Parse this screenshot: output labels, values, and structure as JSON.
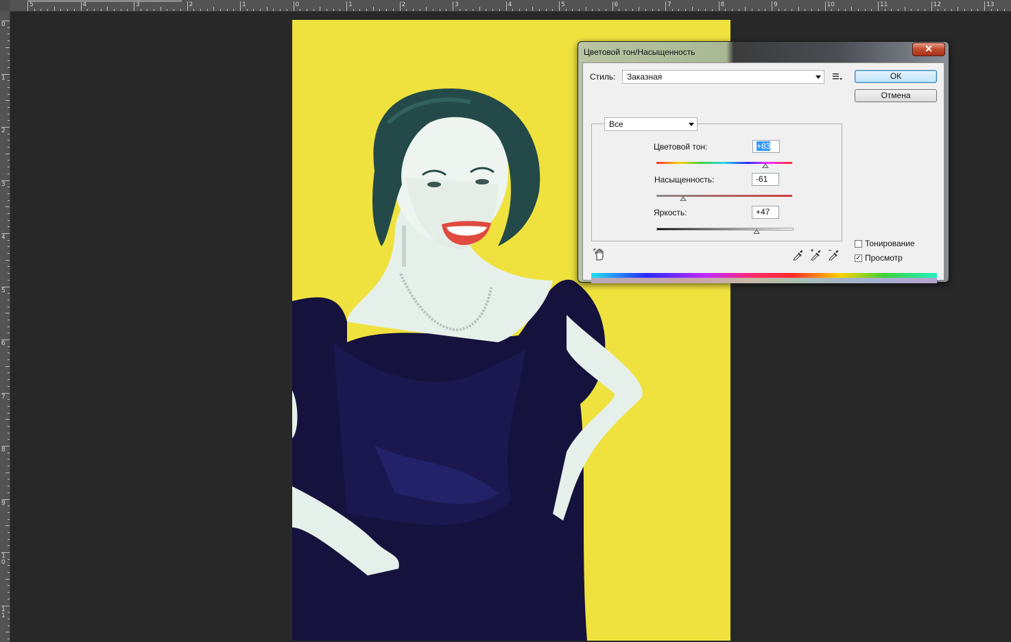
{
  "rulers": {
    "top_labels": [
      "5",
      "4",
      "3",
      "2",
      "1",
      "0",
      "1",
      "2",
      "3",
      "4",
      "5",
      "6",
      "7",
      "8",
      "9",
      "10",
      "11",
      "12",
      "13"
    ],
    "left_labels": [
      "0",
      "1",
      "2",
      "3",
      "4",
      "5",
      "6",
      "7",
      "8",
      "9",
      "1\n0",
      "1\n1"
    ]
  },
  "document": {
    "background_color": "#efe23e"
  },
  "dialog": {
    "title": "Цветовой тон/Насыщенность",
    "close_label": "✕",
    "preset_label": "Стиль:",
    "preset_value": "Заказная",
    "ok_label": "ОК",
    "cancel_label": "Отмена",
    "channel_value": "Все",
    "hue": {
      "label": "Цветовой тон:",
      "value": "+83",
      "slider_fraction": 0.803
    },
    "saturation": {
      "label": "Насыщенность:",
      "value": "-61",
      "slider_fraction": 0.195
    },
    "lightness": {
      "label": "Яркость:",
      "value": "+47",
      "slider_fraction": 0.735
    },
    "colorize_label": "Тонирование",
    "colorize_checked": false,
    "preview_label": "Просмотр",
    "preview_checked": true,
    "preview_check_glyph": "✓"
  }
}
